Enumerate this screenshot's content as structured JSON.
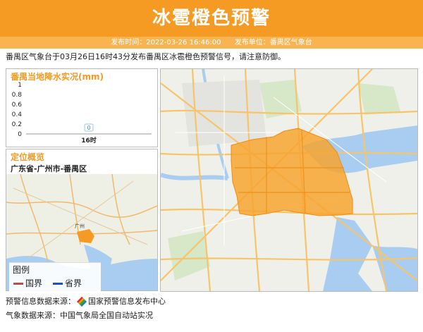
{
  "header": {
    "title": "冰雹橙色预警",
    "publish_time": "发布时间：2022-03-26 16:46:00",
    "publisher": "发布单位：番禺区气象台"
  },
  "description": "番禺区气象台于03月26日16时43分发布番禺区冰雹橙色预警信号，请注意防御。",
  "colors": {
    "accent": "#f59a23",
    "warning_area": "#f7a530"
  },
  "rain_panel": {
    "title": "番禺当地降水实况(mm)",
    "chart_data": {
      "type": "bar",
      "categories": [
        "16时"
      ],
      "values": [
        0
      ],
      "data_labels": [
        "0"
      ],
      "yticks": [
        "1",
        "0.8",
        "0.6",
        "0.4",
        "0.2",
        "0"
      ],
      "ylim": [
        0,
        1
      ]
    }
  },
  "location_panel": {
    "title": "定位概览",
    "region": "广东省-广州市-番禺区",
    "legend": {
      "title": "图例",
      "items": [
        {
          "label": "国界",
          "color": "#c04a4a"
        },
        {
          "label": "省界",
          "color": "#1a4fd0"
        }
      ]
    }
  },
  "footer": {
    "source1_label": "预警信息数据来源：",
    "source1_value": "国家预警信息发布中心",
    "source2": "气象数据来源：中国气象局全国自动站实况"
  }
}
